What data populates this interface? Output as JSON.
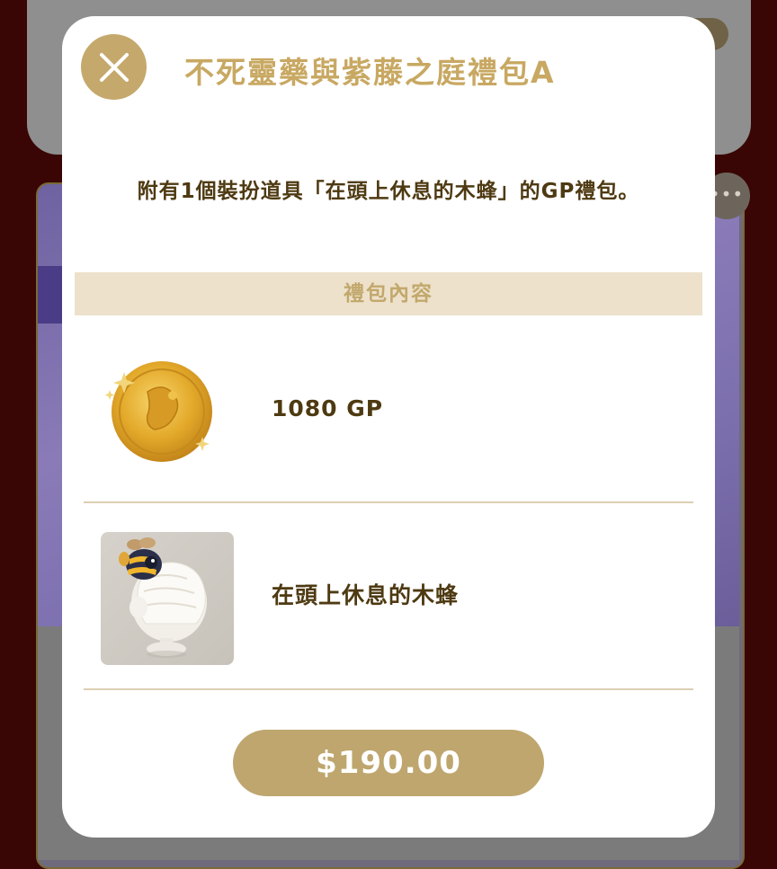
{
  "background": {
    "more_menu_glyph": "•••"
  },
  "modal": {
    "title": "不死靈藥與紫藤之庭禮包A",
    "description": "附有1個裝扮道具「在頭上休息的木蜂」的GP禮包。",
    "section_header": "禮包內容",
    "items": [
      {
        "label": "1080 GP",
        "icon": "gold-coin-icon"
      },
      {
        "label": "在頭上休息的木蜂",
        "icon": "bee-hat-item-icon"
      }
    ],
    "price_label": "$190.00"
  },
  "colors": {
    "accent_gold": "#c5a86c",
    "title_gold": "#c8a862",
    "text_brown": "#4e3a12",
    "section_bg": "#ede1cb",
    "price_button": "#bea66e"
  }
}
